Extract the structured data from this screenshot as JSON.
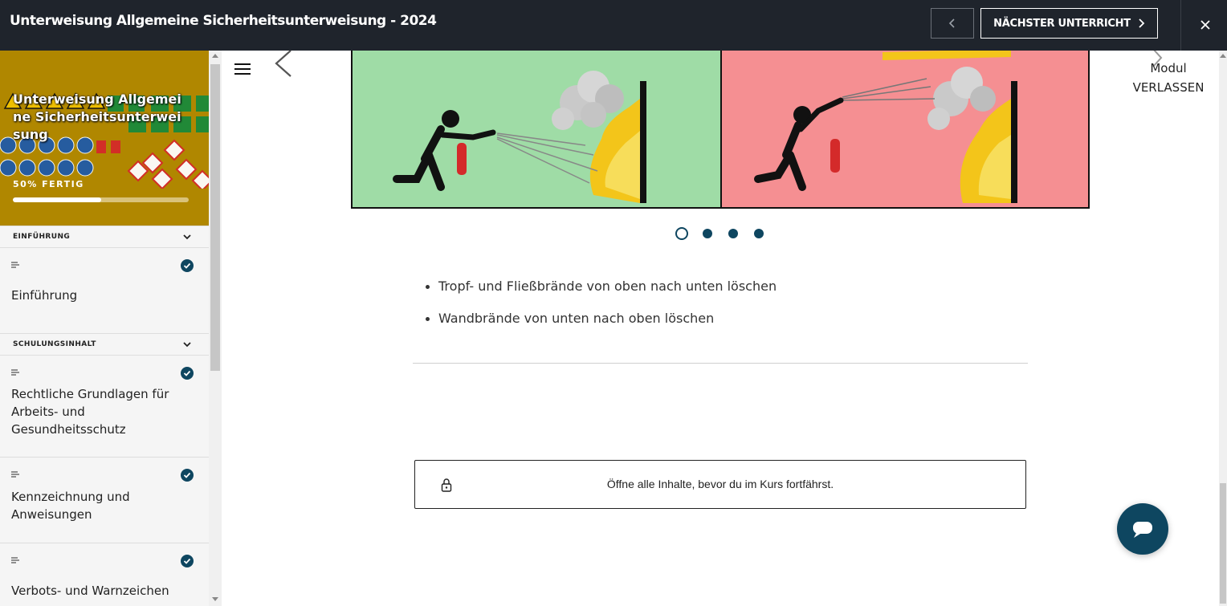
{
  "header": {
    "course_title": "Unterweisung Allgemeine Sicherheitsunterweisung - 2024",
    "prev_icon": "chevron-left-icon",
    "next_label": "NÄCHSTER UNTERRICHT",
    "next_icon": "chevron-right-icon",
    "close_icon": "close-icon"
  },
  "sidebar": {
    "course_title": "Unterweisung Allgemeine Sicherheitsunterweisung",
    "progress_label": "50% FERTIG",
    "progress_fraction": 0.5,
    "sections": [
      {
        "label": "EINFÜHRUNG",
        "lessons": [
          {
            "title": "Einführung",
            "completed": true
          }
        ]
      },
      {
        "label": "SCHULUNGSINHALT",
        "lessons": [
          {
            "title": "Rechtliche Grundlagen für Arbeits- und Gesundheitsschutz",
            "completed": true
          },
          {
            "title": "Kennzeichnung und Anweisungen",
            "completed": true
          },
          {
            "title": "Verbots- und Warnzeichen",
            "completed": true
          }
        ]
      }
    ]
  },
  "main": {
    "menu_icon": "hamburger-icon",
    "exit_line1": "Modul",
    "exit_line2": "VERLASSEN",
    "carousel": {
      "slide_count": 4,
      "active_index": 0,
      "slide_colors": [
        "#9fdca6",
        "#f58f92"
      ]
    },
    "bullets": [
      "Tropf- und Fließbrände von oben nach unten löschen",
      "Wandbrände von unten nach oben löschen"
    ],
    "lock_message": "Öffne alle Inhalte, bevor du im Kurs fortfährst.",
    "lock_icon": "lock-icon",
    "chat_icon": "chat-icon"
  },
  "colors": {
    "topbar": "#1f242c",
    "accent": "#0e4660",
    "sidebar_header": "#b08700"
  }
}
